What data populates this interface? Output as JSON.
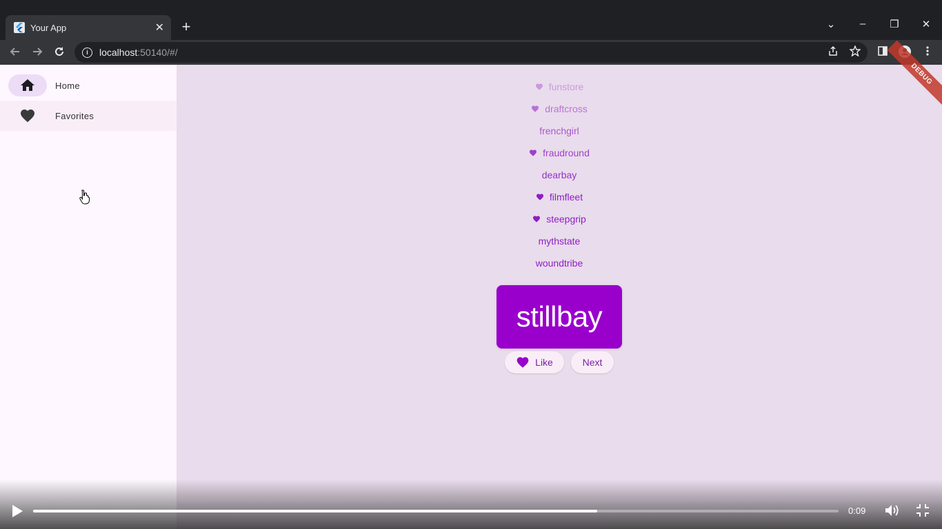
{
  "browser": {
    "tab_title": "Your App",
    "tab_close": "✕",
    "new_tab": "+",
    "url_host": "localhost",
    "url_rest": ":50140/#/",
    "win_min": "–",
    "win_restore": "❐",
    "win_close": "✕",
    "tab_search": "⌄"
  },
  "sidebar": {
    "items": [
      {
        "label": "Home",
        "icon": "home-icon",
        "selected": true
      },
      {
        "label": "Favorites",
        "icon": "heart-icon",
        "selected": false
      }
    ]
  },
  "main": {
    "history": [
      {
        "word": "funstore",
        "liked": true
      },
      {
        "word": "draftcross",
        "liked": true
      },
      {
        "word": "frenchgirl",
        "liked": false
      },
      {
        "word": "fraudround",
        "liked": true
      },
      {
        "word": "dearbay",
        "liked": false
      },
      {
        "word": "filmfleet",
        "liked": true
      },
      {
        "word": "steepgrip",
        "liked": true
      },
      {
        "word": "mythstate",
        "liked": false
      },
      {
        "word": "woundtribe",
        "liked": false
      }
    ],
    "current_pair": "stillbay",
    "like_label": "Like",
    "next_label": "Next",
    "debug_banner": "DEBUG"
  },
  "video": {
    "time": "0:09",
    "progress": 0.7
  },
  "colors": {
    "accent": "#9900cc",
    "history_text": "#8f1ec5",
    "main_bg": "#e9dcec",
    "sidebar_bg": "#fef7ff"
  }
}
